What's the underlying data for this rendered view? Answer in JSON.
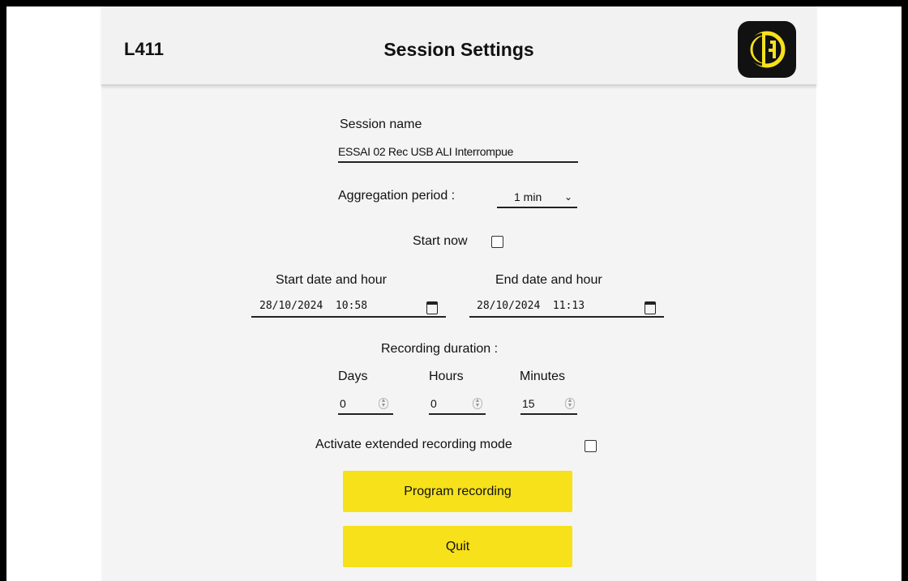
{
  "header": {
    "device": "L411",
    "title": "Session Settings",
    "logo_icon": "ca-logo-icon"
  },
  "colors": {
    "accent": "#f6e11b",
    "background": "#f4f4f4",
    "frame": "#000000"
  },
  "form": {
    "session_name": {
      "label": "Session name",
      "value": "ESSAI 02 Rec USB ALI Interrompue"
    },
    "aggregation": {
      "label": "Aggregation period :",
      "value": "1 min",
      "icon": "chevron-down-icon"
    },
    "start_now": {
      "label": "Start now",
      "checked": false
    },
    "start": {
      "label": "Start date and hour",
      "value": "28/10/2024  10:58"
    },
    "end": {
      "label": "End date and hour",
      "value": "28/10/2024  11:13"
    },
    "duration": {
      "label": "Recording duration :",
      "days": {
        "label": "Days",
        "value": "0"
      },
      "hours": {
        "label": "Hours",
        "value": "0"
      },
      "minutes": {
        "label": "Minutes",
        "value": "15"
      }
    },
    "extended": {
      "label": "Activate extended recording mode",
      "checked": false
    }
  },
  "buttons": {
    "program": "Program recording",
    "quit": "Quit"
  }
}
